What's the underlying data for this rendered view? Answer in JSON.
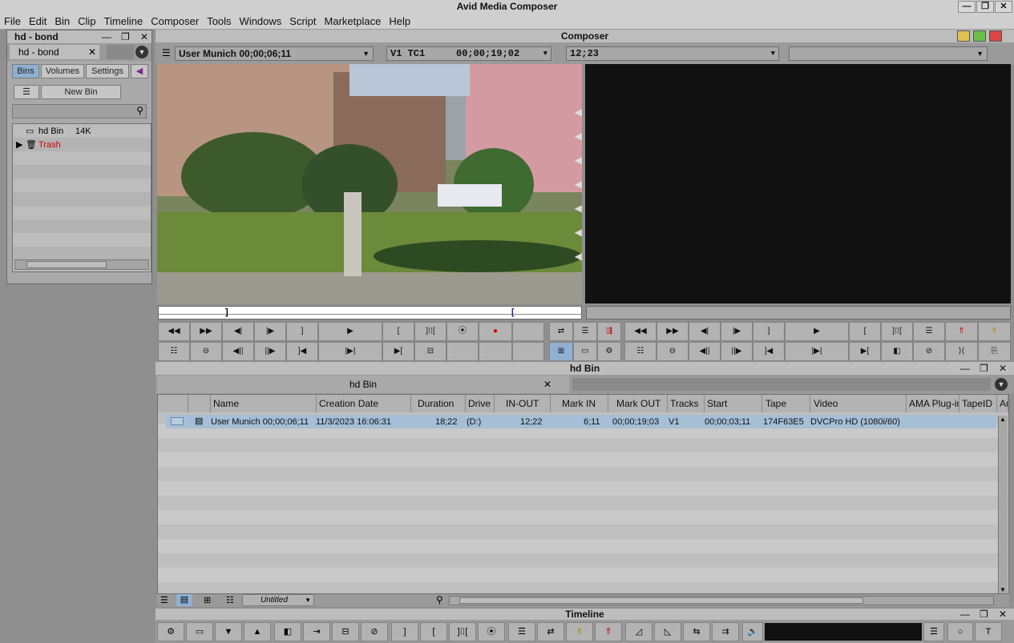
{
  "app": {
    "title": "Avid Media Composer"
  },
  "menu": [
    "File",
    "Edit",
    "Bin",
    "Clip",
    "Timeline",
    "Composer",
    "Tools",
    "Windows",
    "Script",
    "Marketplace",
    "Help"
  ],
  "project": {
    "title": "hd - bond",
    "tab": "hd - bond",
    "tabs": [
      "Bins",
      "Volumes",
      "Settings"
    ],
    "new_bin": "New Bin",
    "search_placeholder": "",
    "bins": [
      {
        "name": "hd Bin",
        "size": "14K"
      },
      {
        "name": "Trash",
        "size": ""
      }
    ]
  },
  "composer": {
    "title": "Composer",
    "source_clip": "User Munich 00;00;06;11",
    "track": "V1",
    "tc_label": "TC1",
    "timecode": "00;00;19;02",
    "duration": "12;23"
  },
  "bin": {
    "title": "hd Bin",
    "tab": "hd Bin",
    "view_name": "Untitled",
    "columns": [
      "Name",
      "Creation Date",
      "Duration",
      "Drive",
      "IN-OUT",
      "Mark IN",
      "Mark OUT",
      "Tracks",
      "Start",
      "Tape",
      "Video",
      "AMA Plug-in",
      "TapeID",
      "Au"
    ],
    "row": {
      "name": "User Munich 00;00;06;11",
      "creation_date": "11/3/2023 16:06:31",
      "duration": "18;22",
      "drive": "(D:)",
      "in_out": "12;22",
      "mark_in": "6;11",
      "mark_out": "00;00;19;03",
      "tracks": "V1",
      "start": "00;00;03;11",
      "tape": "174F63E5",
      "video": "DVCPro HD (1080i/60)"
    }
  },
  "timeline": {
    "title": "Timeline"
  },
  "colors": {
    "accent": "#8fb0d3",
    "trash": "#d40000",
    "chrome": "#bdbdbd"
  }
}
